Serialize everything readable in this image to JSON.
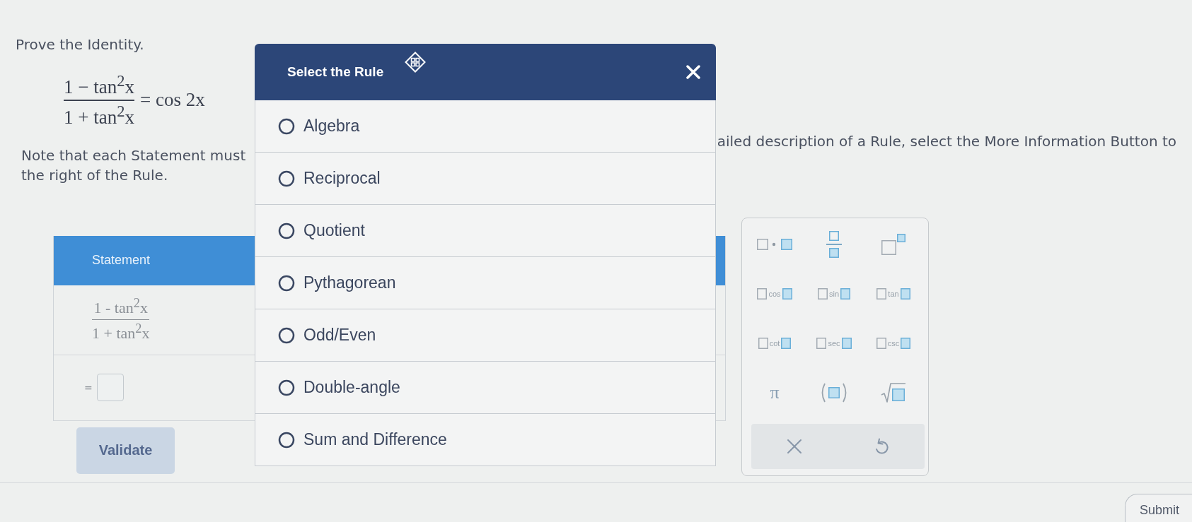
{
  "prompt": {
    "title": "Prove the Identity.",
    "equation": {
      "numerator": "1 − tan$^{2}$x",
      "denominator": "1 + tan$^{2}$x",
      "rhs": "= cos 2x"
    },
    "note_left": "Note that each Statement must",
    "note_right": "ailed description of a Rule, select the More Information Button to",
    "note_line2": "the right of the Rule."
  },
  "proof_table": {
    "header": "Statement",
    "rows": [
      {
        "kind": "fraction",
        "numerator": "1 - tan$^{2}$x",
        "denominator": "1 + tan$^{2}$x"
      },
      {
        "kind": "input",
        "prefix": "="
      }
    ],
    "validate_button": "Validate"
  },
  "palette": {
    "keys": [
      {
        "kind": "product"
      },
      {
        "kind": "fraction"
      },
      {
        "kind": "power"
      },
      {
        "kind": "trig",
        "label": "cos"
      },
      {
        "kind": "trig",
        "label": "sin"
      },
      {
        "kind": "trig",
        "label": "tan"
      },
      {
        "kind": "trig",
        "label": "cot"
      },
      {
        "kind": "trig",
        "label": "sec"
      },
      {
        "kind": "trig",
        "label": "csc"
      },
      {
        "kind": "symbol",
        "label": "π"
      },
      {
        "kind": "parens"
      },
      {
        "kind": "sqrt"
      }
    ],
    "actions": [
      {
        "kind": "clear"
      },
      {
        "kind": "undo"
      }
    ]
  },
  "modal": {
    "title": "Select the Rule",
    "options": [
      {
        "label": "Algebra",
        "selected": false
      },
      {
        "label": "Reciprocal",
        "selected": false
      },
      {
        "label": "Quotient",
        "selected": false
      },
      {
        "label": "Pythagorean",
        "selected": false
      },
      {
        "label": "Odd/Even",
        "selected": false
      },
      {
        "label": "Double-angle",
        "selected": false
      },
      {
        "label": "Sum and Difference",
        "selected": false
      }
    ]
  },
  "submit_button": "Submit"
}
